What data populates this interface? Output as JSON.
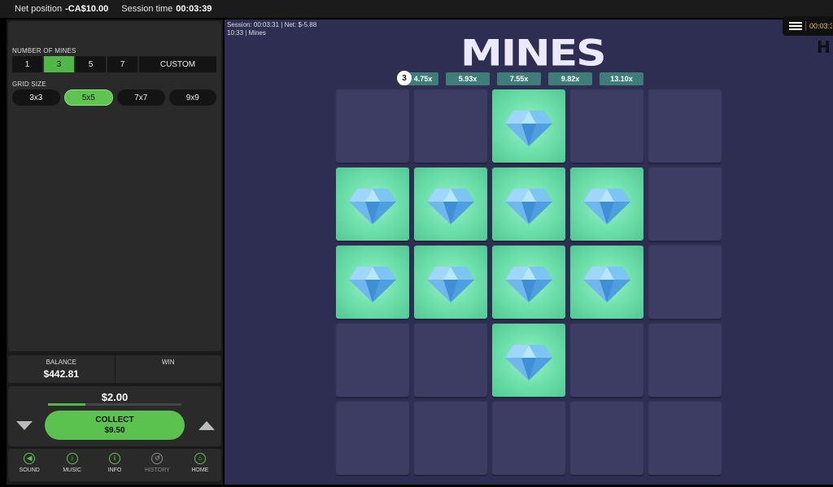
{
  "topbar": {
    "net_label": "Net position",
    "net_value": "-CA$10.00",
    "session_label": "Session time",
    "session_value": "00:03:39"
  },
  "settings": {
    "mines_label": "NUMBER OF MINES",
    "mines_options": [
      "1",
      "3",
      "5",
      "7",
      "CUSTOM"
    ],
    "mines_selected": "3",
    "grid_label": "GRID SIZE",
    "grid_options": [
      "3x3",
      "5x5",
      "7x7",
      "9x9"
    ],
    "grid_selected": "5x5"
  },
  "balance": {
    "balance_label": "BALANCE",
    "balance_value": "$442.81",
    "win_label": "WIN",
    "win_value": ""
  },
  "bet": {
    "amount": "$2.00",
    "progress": 0.28,
    "collect_label": "COLLECT",
    "collect_value": "$9.50"
  },
  "menu": [
    {
      "label": "SOUND",
      "icon": "speaker-icon",
      "glyph": "◀",
      "enabled": true
    },
    {
      "label": "MUSIC",
      "icon": "music-note-icon",
      "glyph": "♪",
      "enabled": true
    },
    {
      "label": "INFO",
      "icon": "info-icon",
      "glyph": "i",
      "enabled": true
    },
    {
      "label": "HISTORY",
      "icon": "history-icon",
      "glyph": "↺",
      "enabled": false
    },
    {
      "label": "HOME",
      "icon": "home-icon",
      "glyph": "⌂",
      "enabled": true
    }
  ],
  "session_info": {
    "line1": "Session: 00:03:31  |  Net:  $-5.88",
    "line2": "10:33  |  Mines"
  },
  "game": {
    "title": "MINES",
    "mine_count": "3",
    "multipliers": [
      "4.75x",
      "5.93x",
      "7.55x",
      "9.82x",
      "13.10x"
    ],
    "board": [
      [
        0,
        0,
        1,
        0,
        0
      ],
      [
        1,
        1,
        1,
        1,
        0
      ],
      [
        1,
        1,
        1,
        1,
        0
      ],
      [
        0,
        0,
        1,
        0,
        0
      ],
      [
        0,
        0,
        0,
        0,
        0
      ]
    ]
  },
  "hud": {
    "time": "00:03:3"
  },
  "colors": {
    "accent_green": "#5cc24f",
    "board_bg": "#2e2e52",
    "tile": "#3d3d63",
    "gem_tile": "#6fe0ac",
    "multiplier": "#3f7d78"
  }
}
